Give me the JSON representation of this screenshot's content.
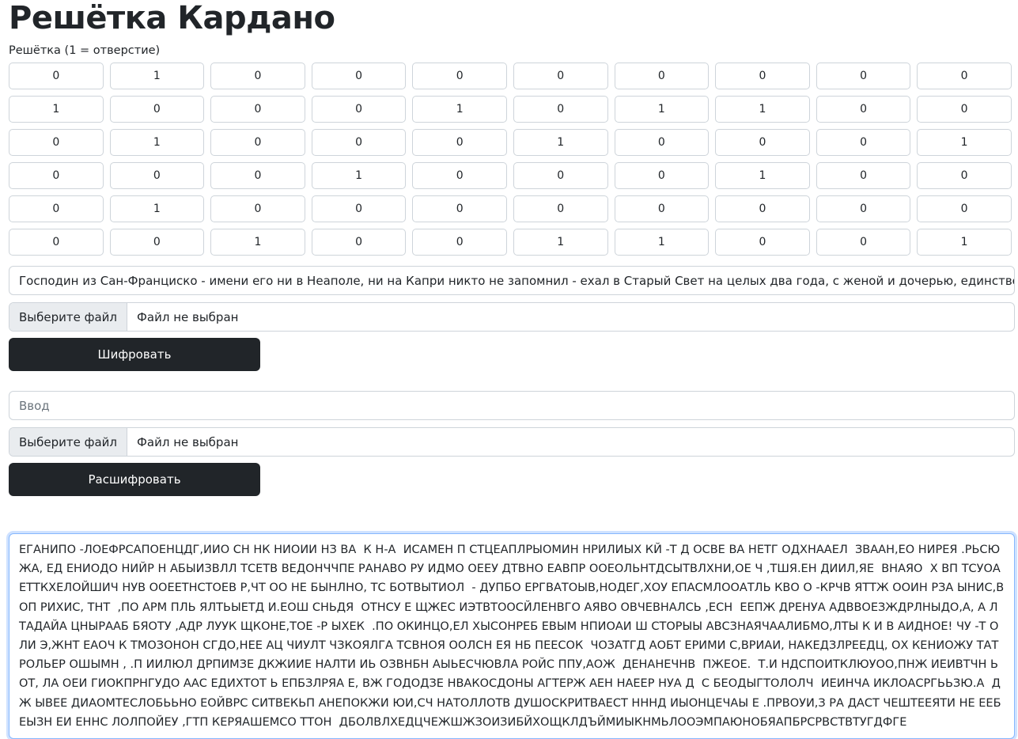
{
  "page": {
    "title": "Решётка Кардано"
  },
  "grid": {
    "label": "Решётка (1 = отверстие)",
    "rows": [
      [
        "0",
        "1",
        "0",
        "0",
        "0",
        "0",
        "0",
        "0",
        "0",
        "0"
      ],
      [
        "1",
        "0",
        "0",
        "0",
        "1",
        "0",
        "1",
        "1",
        "0",
        "0"
      ],
      [
        "0",
        "1",
        "0",
        "0",
        "0",
        "1",
        "0",
        "0",
        "0",
        "1"
      ],
      [
        "0",
        "0",
        "0",
        "1",
        "0",
        "0",
        "0",
        "1",
        "0",
        "0"
      ],
      [
        "0",
        "1",
        "0",
        "0",
        "0",
        "0",
        "0",
        "0",
        "0",
        "0"
      ],
      [
        "0",
        "0",
        "1",
        "0",
        "0",
        "1",
        "1",
        "0",
        "0",
        "1"
      ]
    ]
  },
  "encrypt": {
    "input_value": "Господин из Сан-Франциско - имени его ни в Неаполе, ни на Капри никто не запомнил - ехал в Старый Свет на целых два года, с женой и дочерью, единственно ради р",
    "file_button": "Выберите файл",
    "file_status": "Файл не выбран",
    "submit_label": "Шифровать"
  },
  "decrypt": {
    "input_placeholder": "Ввод",
    "file_button": "Выберите файл",
    "file_status": "Файл не выбран",
    "submit_label": "Расшифровать"
  },
  "output": {
    "text": "ЕГАНИПО -ЛОЕФРСАПОЕНЦДГ,ИИО СН НК НИОИИ НЗ ВА  К Н-А  ИСАМЕН П СТЦЕАПЛРЫОМИН НРИЛИЫХ КЙ -Т Д ОСВЕ ВА НЕТГ ОДХНААЕЛ  ЗВААН,ЕО НИРЕЯ .РЬСЮ ЖА, ЕД ЕНИОДО НИЙР Н АБЫИЗВЛЛ ТСЕТВ ВЕДОНЧЧПЕ РАНАВО РУ ИДМО ОЕЕУ ДТВНО ЕАВПР ООЕОЛЬНТДСЫТВЛХНИ,ОЕ Ч ,ТШЯ.ЕН ДИИЛ,ЯЕ  ВНАЯО  Х ВП ТСУОАЕТТКХЕЛОЙШИЧ НУВ ООЕЕТНСТОЕВ Р,ЧТ ОО НЕ БЫНЛНО, ТС БОТВЫТИОЛ  - ДУПБО ЕРГВАТОЫВ,НОДЕГ,ХОУ ЕПАСМЛООАТЛЬ КВО О -КРЧВ ЯТТЖ ООИН РЗА ЫНИС,ВОП РИХИС, ТНТ  ,ПО АРМ ПЛЬ ЯЛТЬЫЕТД И.ЕОШ СНЬДЯ  ОТНСУ Е ЩЖЕС ИЭТВТООСЙЛЕНВГО АЯВО ОВЧЕВНАЛСЬ ,ЕСН  ЕЕПЖ ДРЕНУА АДВВОЕЗЖДРЛНЫДО,А, А Л ТАДАЙА ЦНЫРААБ БЯОТУ ,АДР ЛУУК ЩКОНЕ,ТОЕ -Р ЫХЕК  .ПО ОКИНЦО,ЕЛ ХЫСОНРЕБ ЕВЫМ НПИОАИ Ш СТОРЫЫ АВСЗНАЯЧААЛИБМО,ЛТЫ К И В АИДНОЕ! ЧУ -Т О ЛИ Э,ЖНТ ЕАОЧ К ТМОЗОНОН СГДО,НЕЕ АЦ ЧИУЛТ ЧЗКОЯЛГА ТСВНОЯ ООЛСН ЕЯ НБ ПЕЕСОК  ЧОЗАТГД АОБТ ЕРИМИ С,ВРИАИ, НАКЕДЗЛРЕЕДЦ, ОХ КЕНИОЖУ ТАТРОЛЬЕР ОШЫМН , .П ИИЛЮЛ ДРПИМЗЕ ДКЖИИЕ НАЛТИ ИЬ ОЗВНБН АЫЬЕСЧЮВЛА РОЙС ППУ,АОЖ  ДЕНАНЕЧНВ  ПЖЕОЕ.  Т.И НДСПОИТКЛЮУОО,ПНЖ ИЕИВТЧН Ь ОТ, ЛА ОЕИ ГИОКПРНГУДО ААС ЕДИХТОТ Ь ЕПБЗЛРЯА Е, ВЖ ГОДОДЗЕ НВАКОСДОНЫ АГТЕРЖ АЕН НАЕЕР НУА Д  С БЕОДЫГТОЛОЛЧ  ИЕИНЧА ИКЛОАСРГЬЬЗЮ.А  ДЖ ЫВЕЕ ДИАОМТЕСЛОБЬЬНО ЕОЙВРС СИТВЕКЬП АНЕПОКЖИ ЮИ,СЧ НАТОЛЛОТВ ДУШОСКРИТВАЕСТ НННД ИЫОНЦЕЧАЫ Е .ПРВОУИ,З РА ДАСТ ЧЕШТЕЕЯТИ НЕ ЕЕБЕЫЗН ЕИ ЕННС ЛОЛПОЙЕУ ,ГТП КЕРЯАШЕМСО ТТОН  ДБОЛВЛХЕДЦЧЕЖШЖЗОИЗИБЙХОЩКЛДЪЙМИЫКНМЬЛООЭМПАЮНОБЯАПБРСРВСТВТУГДФГЕ"
  }
}
